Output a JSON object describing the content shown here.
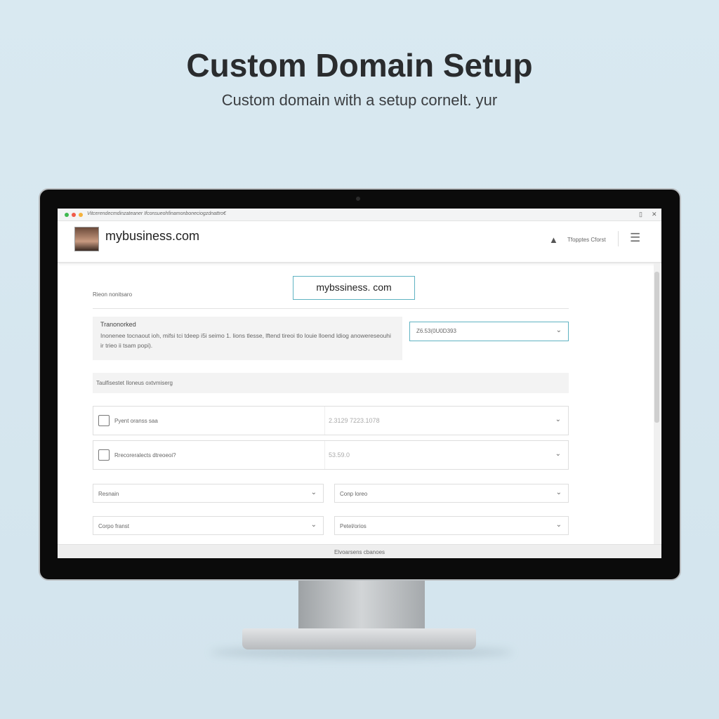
{
  "title": "Custom Domain Setup",
  "subtitle": "Custom domain with a setup cornelt. yur",
  "browser": {
    "address": "Vitcerendecmdinzateaner Ifconsueohfinamonboneciogzdnattro€",
    "dots": [
      "#3fb950",
      "#f05a4a",
      "#f5b23c"
    ]
  },
  "header": {
    "brand": "mybusiness.com",
    "user": "Tfopptes Cforst"
  },
  "form": {
    "label": "Rieon nonitsaro",
    "domain_value": "mybssiness. com",
    "info_title": "Tranonorked",
    "info_text": "Inonenee tocnaout ioh, mifsi tci tdeep i5i seimo 1. lions tlesse, lftend tireoi tlo louie lloend ldiog anowereseouhi ir trieo ii tsam popi).",
    "select_value": "Z6.53(0U0D393",
    "section": "Taulfisestet Iloneus oxtvmiserg",
    "rows": [
      {
        "label": "Pyent oranss saa",
        "value": "2.3129 7223.1078"
      },
      {
        "label": "Rrecoreralects dtreoeoi?",
        "value": "53.59.0"
      }
    ],
    "selects": [
      "Resnain",
      "Conp loreo",
      "Corpo franst",
      "Petel/orios"
    ],
    "footer": "Elvoarsens cbanoes"
  },
  "colors": {
    "accent": "#5fb3c2",
    "background": "#d6e7ef"
  }
}
